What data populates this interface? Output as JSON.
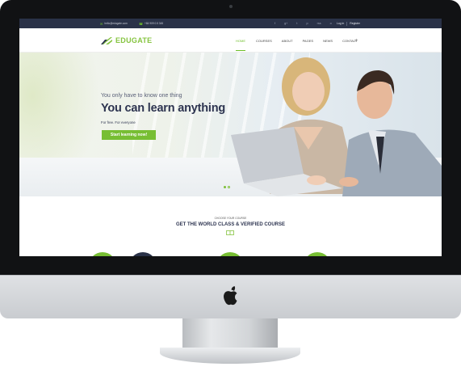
{
  "topbar": {
    "email": "hello@edugate.com",
    "phone": "+84 909 0.5 345",
    "social": [
      "f",
      "g+",
      "t",
      "p",
      "rss",
      "o"
    ],
    "login": "Log in",
    "register": "Register"
  },
  "brand": {
    "name": "EDUGATE"
  },
  "nav": {
    "items": [
      "HOME",
      "COURSES",
      "ABOUT",
      "PAGES",
      "NEWS",
      "CONTACT"
    ],
    "active": "HOME"
  },
  "hero": {
    "pre_title": "You only have to know one thing",
    "title": "You can learn anything",
    "subtitle": "For free. For everyone",
    "cta": "Start learning now!"
  },
  "courses": {
    "label": "CHOOSE YOUR COURSE",
    "title": "GET THE WORLD CLASS & VERIFIED COURSE"
  },
  "colors": {
    "accent": "#77be33",
    "navy": "#2a3248",
    "title": "#2d3450"
  },
  "icons": {
    "email": "envelope-icon",
    "phone": "phone-icon",
    "search": "search-icon",
    "apple": "apple-logo"
  }
}
